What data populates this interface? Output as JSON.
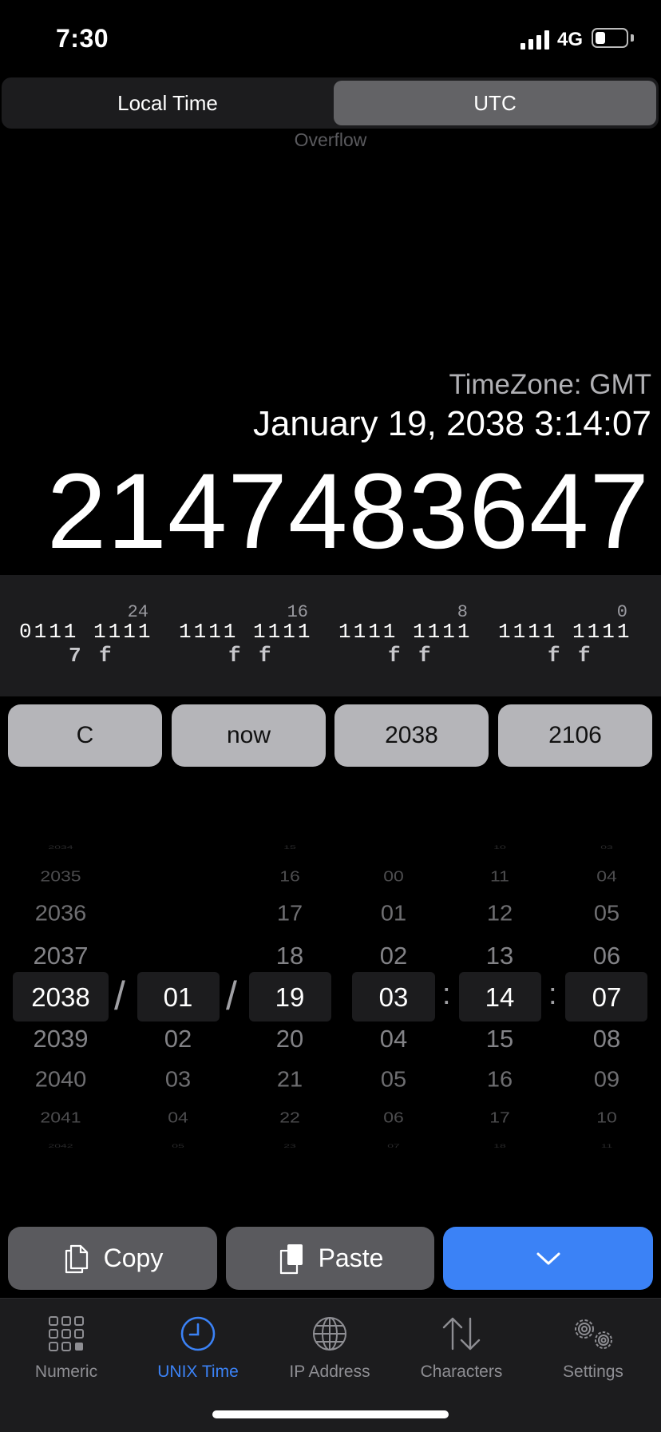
{
  "status_bar": {
    "time": "7:30",
    "network": "4G",
    "battery_level": 0.25
  },
  "segmented": {
    "options": [
      "Local Time",
      "UTC"
    ],
    "selected": "UTC"
  },
  "overflow_label": "Overflow",
  "display": {
    "timezone": "TimeZone: GMT",
    "date": "January 19, 2038 3:14:07",
    "unix_value": "2147483647"
  },
  "binary": [
    {
      "position": "24",
      "bits": "0111 1111",
      "hex": [
        "7",
        "f"
      ]
    },
    {
      "position": "16",
      "bits": "1111 1111",
      "hex": [
        "f",
        "f"
      ]
    },
    {
      "position": "8",
      "bits": "1111 1111",
      "hex": [
        "f",
        "f"
      ]
    },
    {
      "position": "0",
      "bits": "1111 1111",
      "hex": [
        "f",
        "f"
      ]
    }
  ],
  "quick_buttons": [
    "C",
    "now",
    "2038",
    "2106"
  ],
  "picker": {
    "year": {
      "above": [
        "2034",
        "2035",
        "2036",
        "2037"
      ],
      "selected": "2038",
      "below": [
        "2039",
        "2040",
        "2041",
        "2042"
      ]
    },
    "month": {
      "above": [],
      "selected": "01",
      "below": [
        "02",
        "03",
        "04",
        "05"
      ]
    },
    "day": {
      "above": [
        "15",
        "16",
        "17",
        "18"
      ],
      "selected": "19",
      "below": [
        "20",
        "21",
        "22",
        "23"
      ]
    },
    "hour": {
      "above": [
        "00",
        "01",
        "02"
      ],
      "selected": "03",
      "below": [
        "04",
        "05",
        "06",
        "07"
      ]
    },
    "minute": {
      "above": [
        "10",
        "11",
        "12",
        "13"
      ],
      "selected": "14",
      "below": [
        "15",
        "16",
        "17",
        "18"
      ]
    },
    "second": {
      "above": [
        "03",
        "04",
        "05",
        "06"
      ],
      "selected": "07",
      "below": [
        "08",
        "09",
        "10",
        "11"
      ]
    },
    "date_separator": "/",
    "time_separator": ":"
  },
  "actions": {
    "copy": "Copy",
    "paste": "Paste"
  },
  "tabs": [
    {
      "label": "Numeric",
      "icon": "grid-icon",
      "active": false
    },
    {
      "label": "UNIX Time",
      "icon": "clock-icon",
      "active": true
    },
    {
      "label": "IP Address",
      "icon": "globe-icon",
      "active": false
    },
    {
      "label": "Characters",
      "icon": "arrows-icon",
      "active": false
    },
    {
      "label": "Settings",
      "icon": "gears-icon",
      "active": false
    }
  ],
  "colors": {
    "accent": "#3b82f6",
    "background": "#000000",
    "panel": "#1c1c1e"
  }
}
